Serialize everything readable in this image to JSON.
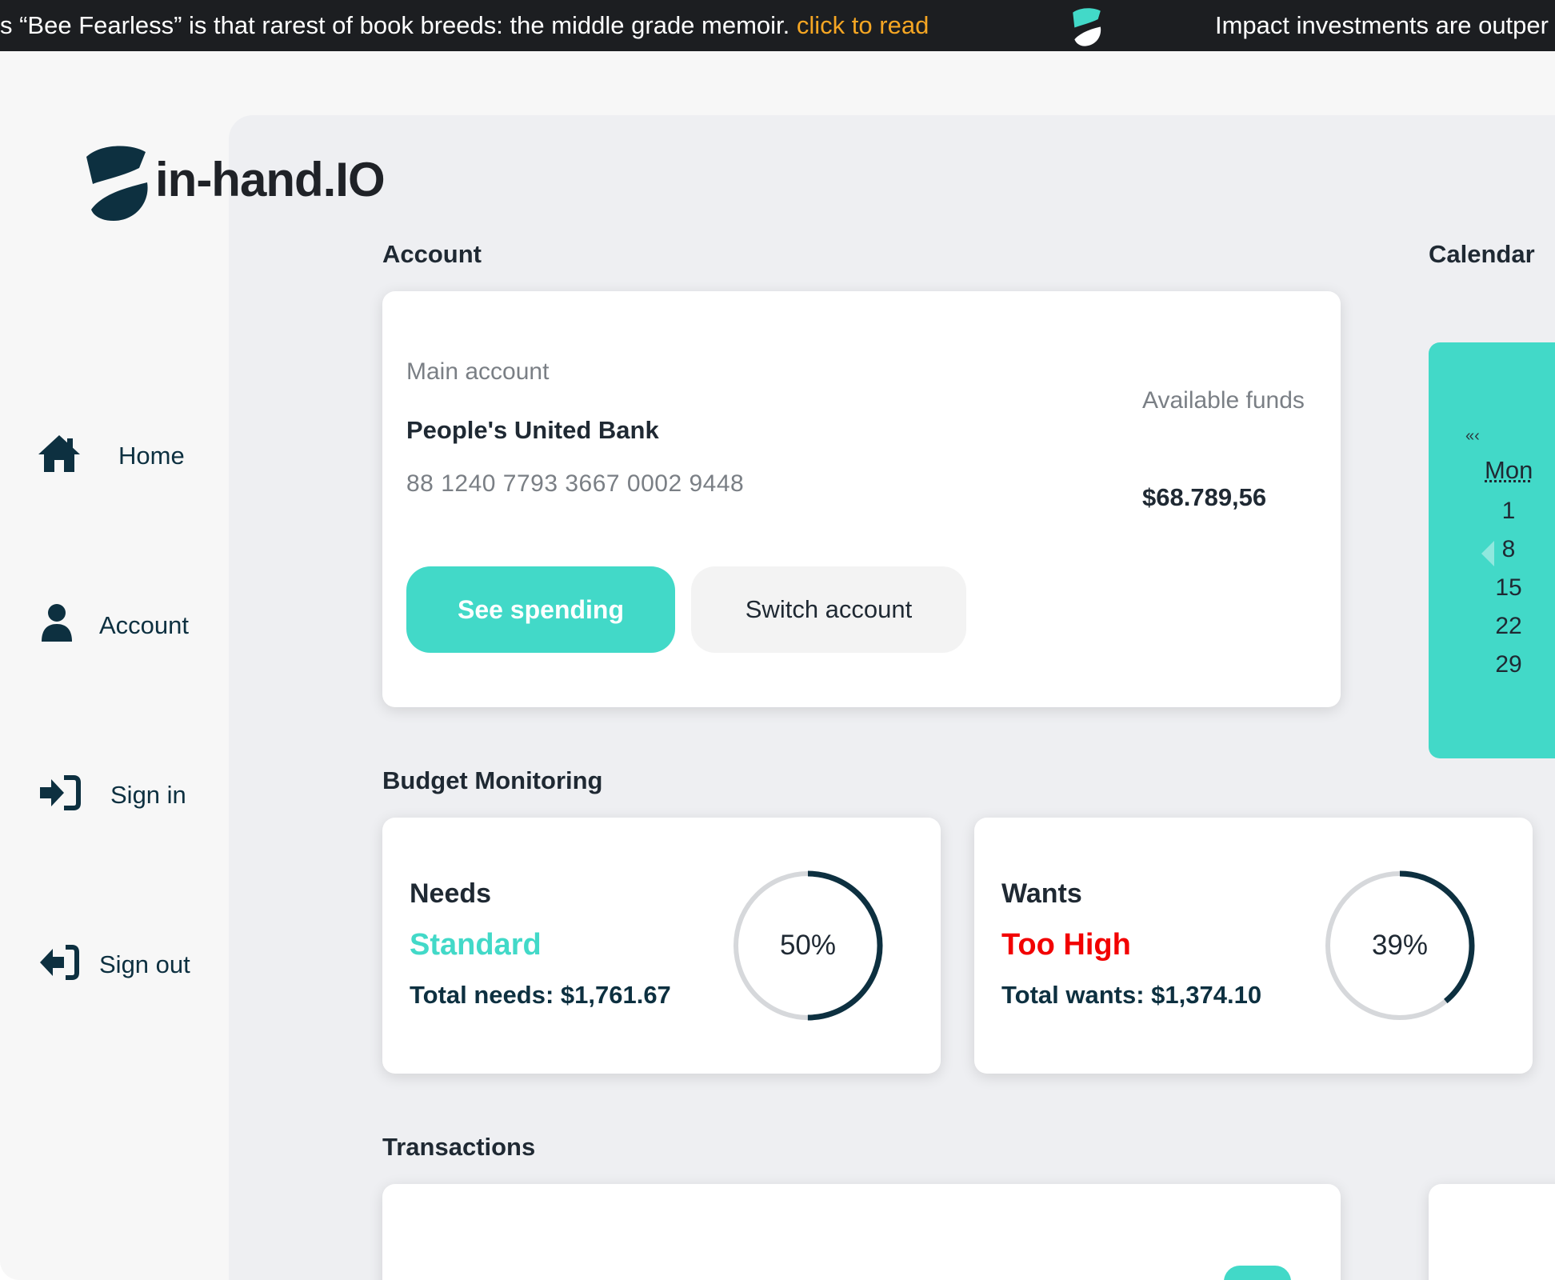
{
  "ticker": {
    "headline_1": "s “Bee Fearless” is that rarest of book breeds: the middle grade memoir.",
    "link_1": "click to read",
    "headline_2": "Impact investments are outper"
  },
  "brand": {
    "name": "in-hand.IO"
  },
  "nav": {
    "items": [
      {
        "label": "Home",
        "icon": "home-icon"
      },
      {
        "label": "Account",
        "icon": "user-icon"
      },
      {
        "label": "Sign in",
        "icon": "sign-in-icon"
      },
      {
        "label": "Sign out",
        "icon": "sign-out-icon"
      }
    ]
  },
  "sections": {
    "account": "Account",
    "calendar": "Calendar",
    "budget": "Budget Monitoring",
    "transactions": "Transactions"
  },
  "account": {
    "main_label": "Main account",
    "bank": "People's United Bank",
    "number": "88 1240 7793 3667 0002 9448",
    "funds_label": "Available funds",
    "funds": "$68.789,56",
    "primary_button": "See spending",
    "secondary_button": "Switch account"
  },
  "calendar": {
    "prev": "«‹",
    "day_head": "Mon",
    "dates": [
      "1",
      "8",
      "15",
      "22",
      "29"
    ]
  },
  "budget": {
    "needs": {
      "title": "Needs",
      "status": "Standard",
      "status_color": "#42d9c8",
      "total": "Total needs: $1,761.67",
      "percent_label": "50%",
      "percent": 50
    },
    "wants": {
      "title": "Wants",
      "status": "Too High",
      "status_color": "#f20000",
      "total": "Total wants: $1,374.10",
      "percent_label": "39%",
      "percent": 39
    }
  },
  "colors": {
    "accent": "#42d9c8",
    "dark": "#0d3040",
    "ticker_bg": "#1c1e21",
    "ticker_link": "#f5a623",
    "alert": "#f20000"
  }
}
